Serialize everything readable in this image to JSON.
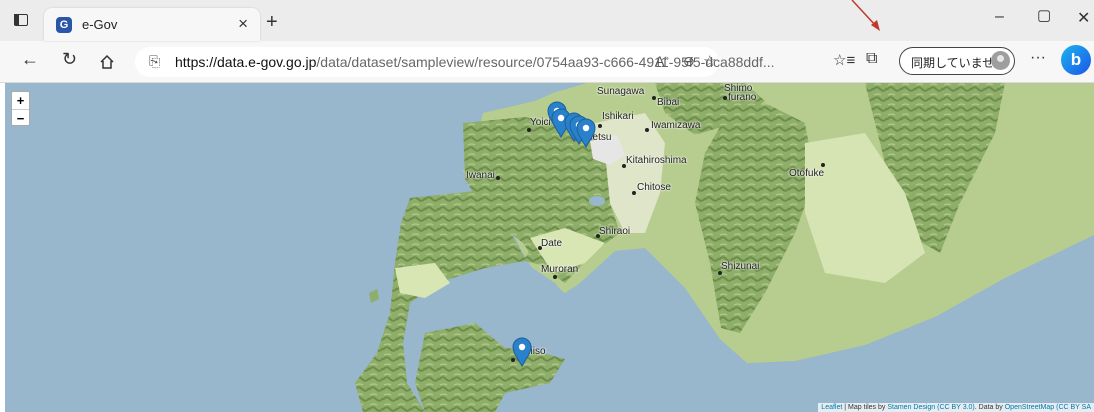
{
  "browser": {
    "tab_title": "e-Gov",
    "tab_favicon_letter": "G",
    "url_domain": "https://data.e-gov.go.jp",
    "url_path": "/data/dataset/sampleview/resource/0754aa93-c666-4911-95f5-dca88ddf...",
    "sync_label": "同期していません",
    "colors": {
      "bing_start": "#1bb4f0",
      "bing_end": "#1c56e8",
      "favicon": "#2a55a8"
    }
  },
  "map": {
    "zoom_in": "+",
    "zoom_out": "−",
    "places": {
      "sunagawa": "Sunagawa",
      "bibai": "Bibai",
      "shimo": "Shimo",
      "furano": "furano",
      "yoichi": "Yoici",
      "ishikari": "Ishikari",
      "iwamizawa": "Iwamizawa",
      "ebetsu": "betsu",
      "kitahiroshima": "Kitahiroshima",
      "otofuke": "Otofuke",
      "iwanai": "Iwanai",
      "chitose": "Chitose",
      "shiraoi": "Shiraoi",
      "date": "Date",
      "muroran": "Muroran",
      "shizunai": "Shizunai",
      "esashi": "hiiso"
    },
    "marker_color": "#2a81cb",
    "attribution": {
      "leaflet": "Leaflet",
      "sep1": " | Map tiles by ",
      "stamen": "Stamen Design",
      "cc1": "(CC BY 3.0)",
      "sep2": ". Data by ",
      "osm": "OpenStreetMap",
      "cc2": "(CC BY SA"
    }
  }
}
